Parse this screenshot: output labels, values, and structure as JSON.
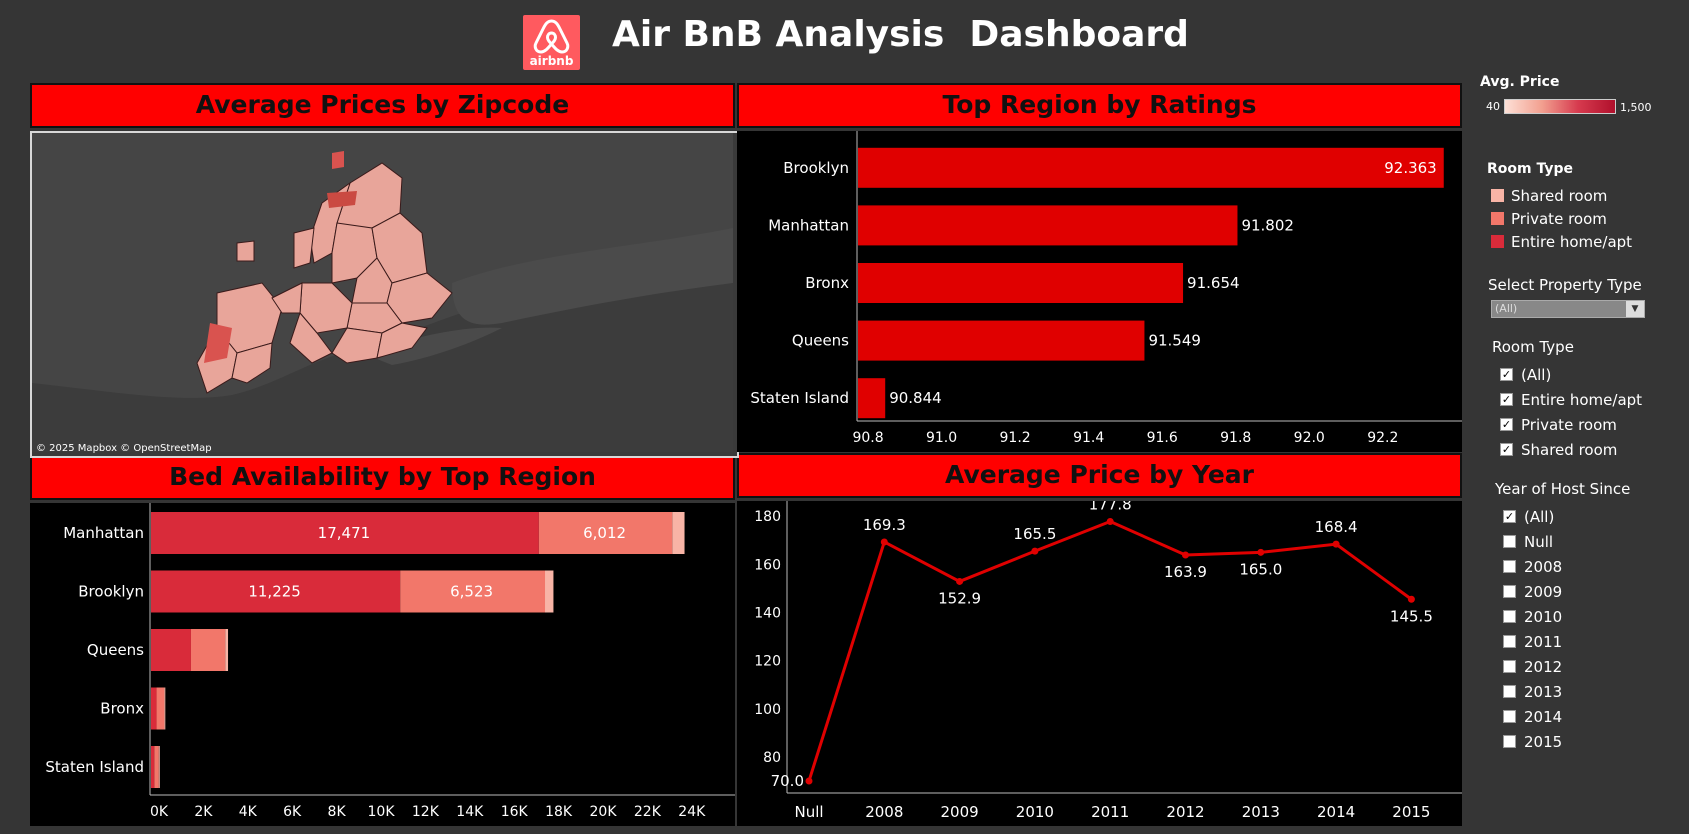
{
  "header": {
    "logo_text": "airbnb",
    "title": "Air BnB Analysis  Dashboard"
  },
  "panels": {
    "map_title": "Average Prices by Zipcode",
    "ratings_title": "Top Region by Ratings",
    "beds_title": "Bed Availability by Top Region",
    "year_title": "Average Price by Year",
    "map_attribution": "© 2025 Mapbox © OpenStreetMap"
  },
  "colors": {
    "header_red": "#ff0000",
    "bar_red": "#e00000",
    "entire_home": "#d92b3a",
    "private_room": "#f2776a",
    "shared_room": "#f8b4a6",
    "line_red": "#e00000",
    "map_zip": "#e8a59a"
  },
  "sidebar": {
    "avg_price_title": "Avg. Price",
    "avg_price_min": "40",
    "avg_price_max": "1,500",
    "room_type_legend_title": "Room Type",
    "room_type_legend": [
      "Shared room",
      "Private room",
      "Entire home/apt"
    ],
    "property_filter_title": "Select Property Type",
    "property_filter_value": "(All)",
    "room_filter_title": "Room Type",
    "room_filter_options": [
      {
        "label": "(All)",
        "checked": true
      },
      {
        "label": "Entire home/apt",
        "checked": true
      },
      {
        "label": "Private room",
        "checked": true
      },
      {
        "label": "Shared room",
        "checked": true
      }
    ],
    "year_filter_title": "Year of Host Since",
    "year_filter_options": [
      {
        "label": "(All)",
        "checked": true
      },
      {
        "label": "Null",
        "checked": false
      },
      {
        "label": "2008",
        "checked": false
      },
      {
        "label": "2009",
        "checked": false
      },
      {
        "label": "2010",
        "checked": false
      },
      {
        "label": "2011",
        "checked": false
      },
      {
        "label": "2012",
        "checked": false
      },
      {
        "label": "2013",
        "checked": false
      },
      {
        "label": "2014",
        "checked": false
      },
      {
        "label": "2015",
        "checked": false
      }
    ]
  },
  "chart_data": [
    {
      "type": "bar",
      "orientation": "horizontal",
      "title": "Top Region by Ratings",
      "categories": [
        "Brooklyn",
        "Manhattan",
        "Bronx",
        "Queens",
        "Staten Island"
      ],
      "values": [
        92.363,
        91.802,
        91.654,
        91.549,
        90.844
      ],
      "value_labels": [
        "92.363",
        "91.802",
        "91.654",
        "91.549",
        "90.844"
      ],
      "xlim": [
        90.77,
        92.38
      ],
      "xticks": [
        90.8,
        91.0,
        91.2,
        91.4,
        91.6,
        91.8,
        92.0,
        92.2
      ],
      "xtick_labels": [
        "90.8",
        "91.0",
        "91.2",
        "91.4",
        "91.6",
        "91.8",
        "92.0",
        "92.2"
      ]
    },
    {
      "type": "bar",
      "orientation": "horizontal",
      "stacked": true,
      "title": "Bed Availability by Top Region",
      "categories": [
        "Manhattan",
        "Brooklyn",
        "Queens",
        "Bronx",
        "Staten Island"
      ],
      "series": [
        {
          "name": "Entire home/apt",
          "values": [
            17471,
            11225,
            1800,
            250,
            150
          ],
          "labels": [
            "17,471",
            "11,225",
            "",
            "",
            ""
          ]
        },
        {
          "name": "Private room",
          "values": [
            6012,
            6523,
            1550,
            350,
            200
          ],
          "labels": [
            "6,012",
            "6,523",
            "",
            "",
            ""
          ]
        },
        {
          "name": "Shared room",
          "values": [
            550,
            380,
            120,
            40,
            20
          ],
          "labels": [
            "",
            "",
            "",
            "",
            ""
          ]
        }
      ],
      "xlim": [
        0,
        25000
      ],
      "xticks": [
        0,
        2000,
        4000,
        6000,
        8000,
        10000,
        12000,
        14000,
        16000,
        18000,
        20000,
        22000,
        24000
      ],
      "xtick_labels": [
        "0K",
        "2K",
        "4K",
        "6K",
        "8K",
        "10K",
        "12K",
        "14K",
        "16K",
        "18K",
        "20K",
        "22K",
        "24K"
      ]
    },
    {
      "type": "line",
      "title": "Average Price by Year",
      "x": [
        "Null",
        "2008",
        "2009",
        "2010",
        "2011",
        "2012",
        "2013",
        "2014",
        "2015"
      ],
      "y": [
        70.0,
        169.3,
        152.9,
        165.5,
        177.8,
        163.9,
        165.0,
        168.4,
        145.5
      ],
      "point_labels": [
        "70.0",
        "169.3",
        "152.9",
        "165.5",
        "177.8",
        "163.9",
        "165.0",
        "168.4",
        "145.5"
      ],
      "label_position": [
        "left",
        "above",
        "below",
        "above",
        "above",
        "below",
        "below",
        "above",
        "below"
      ],
      "ylim": [
        65,
        183
      ],
      "yticks": [
        80,
        100,
        120,
        140,
        160,
        180
      ],
      "ytick_labels": [
        "80",
        "100",
        "120",
        "140",
        "160",
        "180"
      ]
    }
  ]
}
